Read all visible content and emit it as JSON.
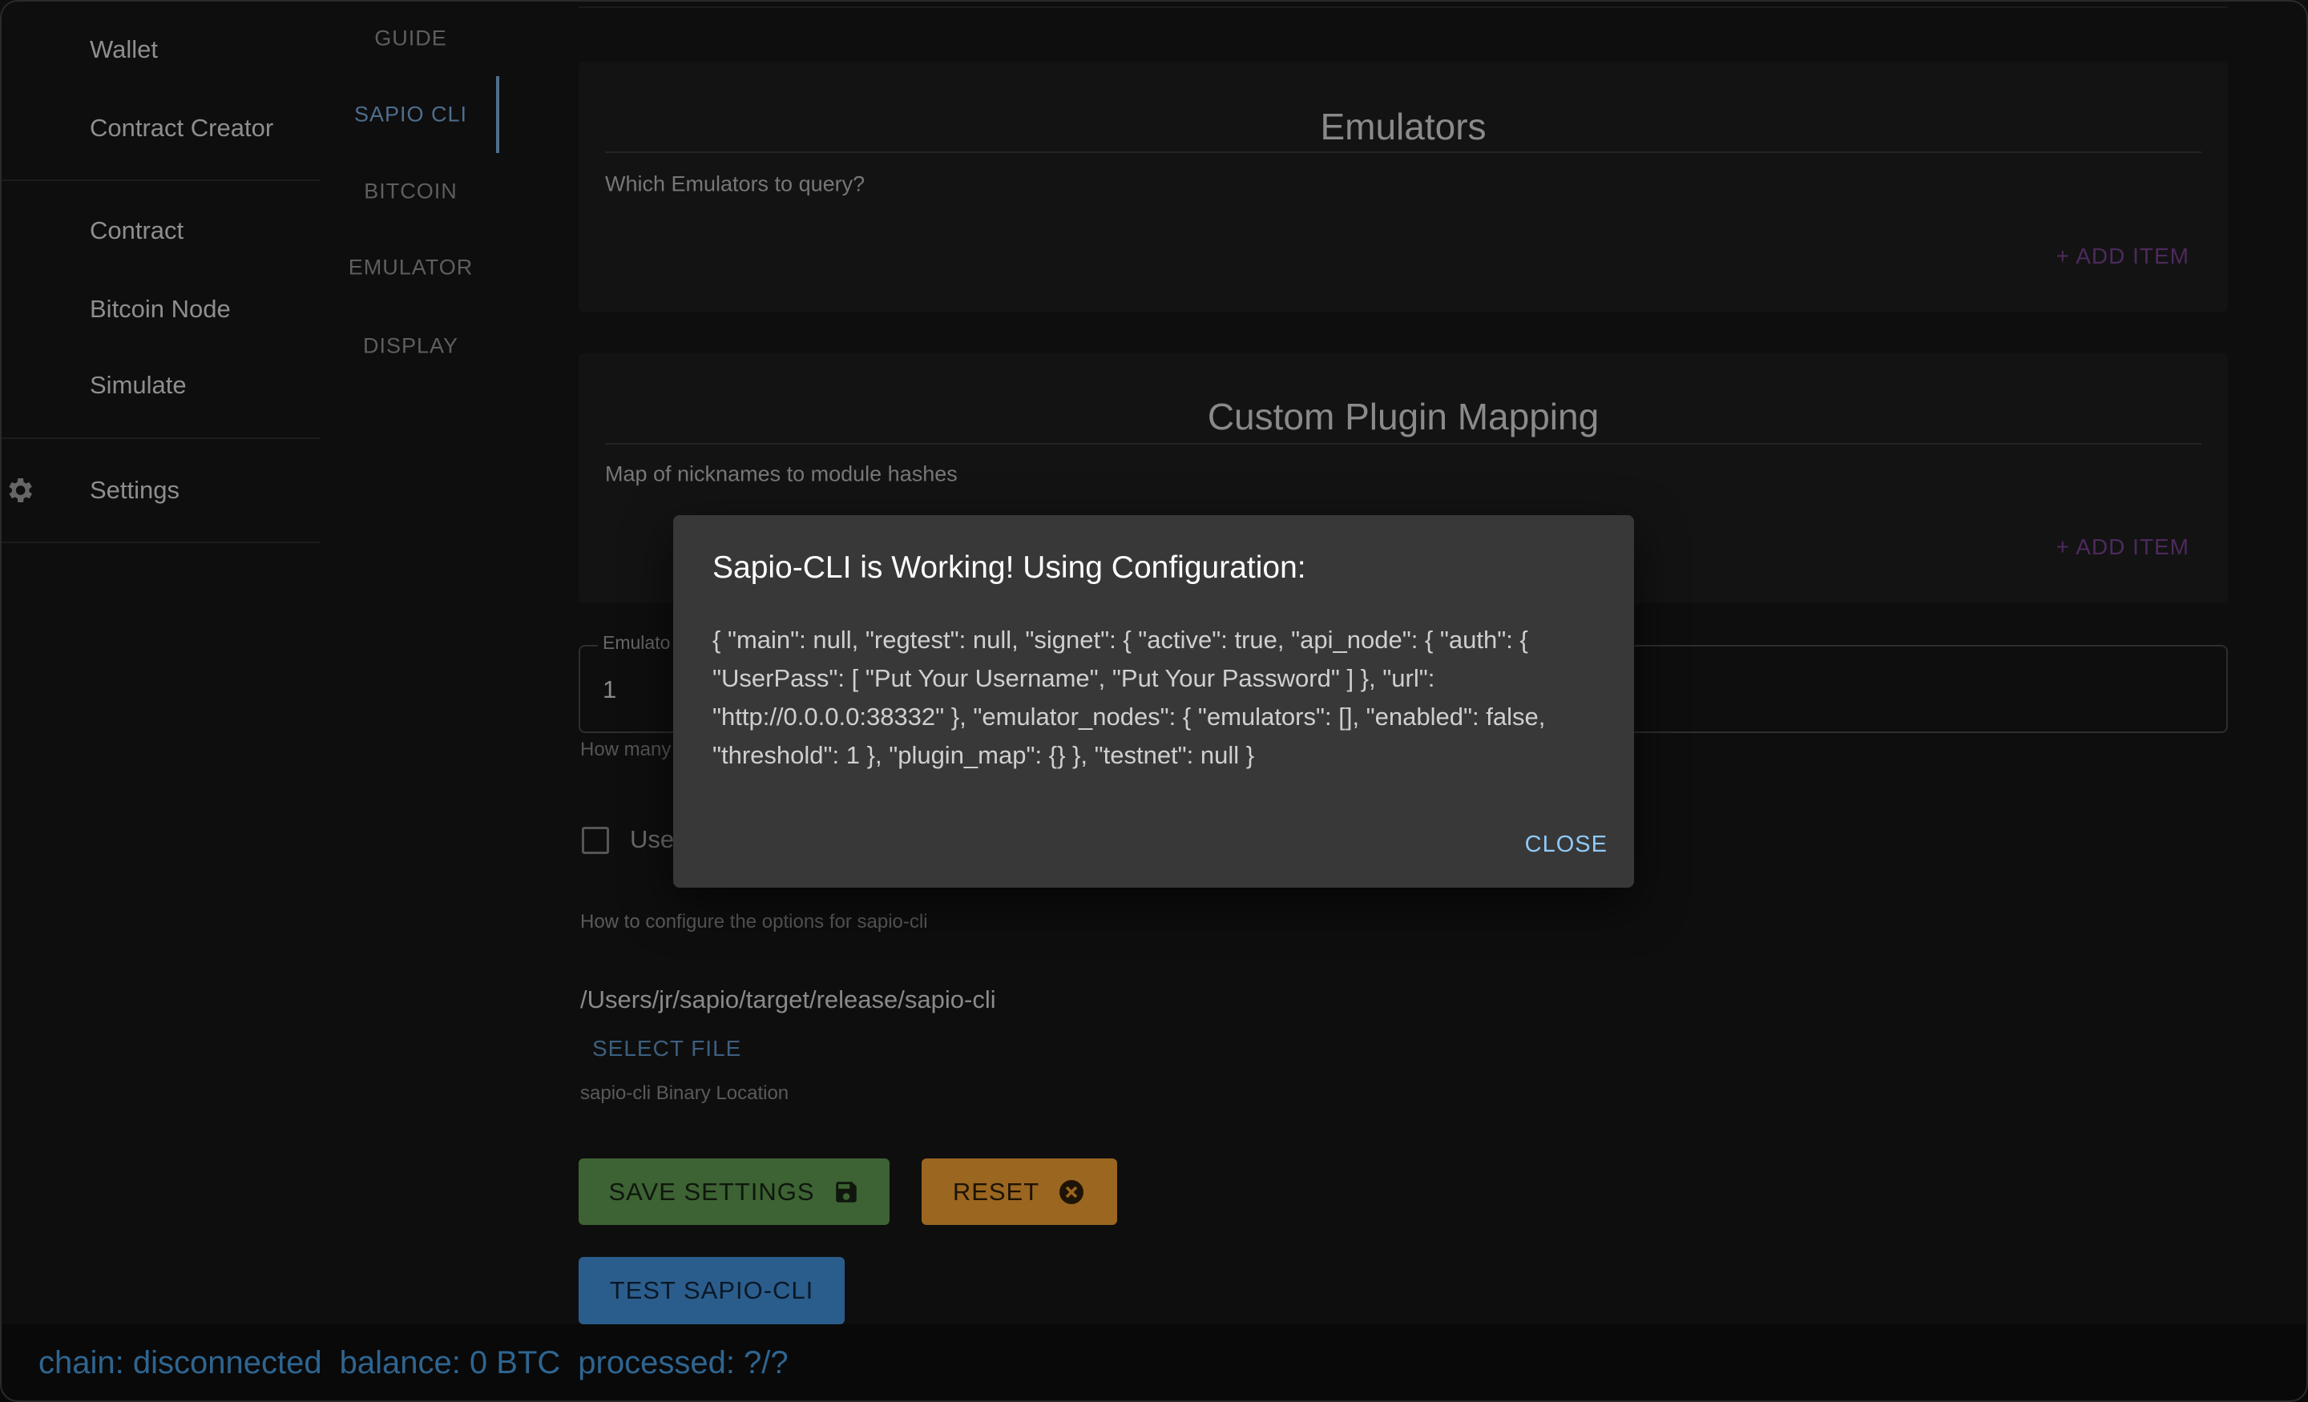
{
  "sidebar": {
    "items": [
      "Wallet",
      "Contract Creator",
      "Contract",
      "Bitcoin Node",
      "Simulate",
      "Settings"
    ]
  },
  "tabs": [
    "GUIDE",
    "SAPIO CLI",
    "BITCOIN",
    "EMULATOR",
    "DISPLAY"
  ],
  "emulators_card": {
    "title": "Emulators",
    "subtitle": "Which Emulators to query?",
    "add": "ADD ITEM"
  },
  "plugin_card": {
    "title": "Custom Plugin Mapping",
    "subtitle": "Map of nicknames to module hashes",
    "add": "ADD ITEM"
  },
  "threshold_field": {
    "label": "Emulato",
    "value": "1",
    "helper": "How many"
  },
  "checkbox": {
    "label": "Use"
  },
  "config_help": "How to configure the options for sapio-cli",
  "binary": {
    "path": "/Users/jr/sapio/target/release/sapio-cli",
    "select": "SELECT FILE",
    "label": "sapio-cli Binary Location"
  },
  "buttons": {
    "save": "SAVE SETTINGS",
    "reset": "RESET",
    "test": "TEST SAPIO-CLI"
  },
  "status": {
    "chain": "chain: disconnected",
    "balance": "balance: 0 BTC",
    "processed": "processed: ?/?"
  },
  "dialog": {
    "title": "Sapio-CLI is Working! Using Configuration:",
    "lines": [
      "{ \"main\": null, \"regtest\": null, \"signet\": { \"active\": true, \"api_node\": { \"auth\": {",
      "\"UserPass\": [ \"Put Your Username\", \"Put Your Password\" ] }, \"url\":",
      "\"http://0.0.0.0:38332\" }, \"emulator_nodes\": { \"emulators\": [], \"enabled\": false,",
      "\"threshold\": 1 }, \"plugin_map\": {} }, \"testnet\": null }"
    ],
    "close": "CLOSE"
  }
}
